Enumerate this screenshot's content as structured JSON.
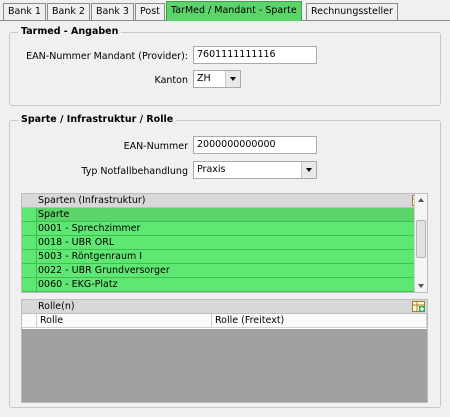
{
  "tabs": [
    {
      "label": "Bank 1",
      "active": false
    },
    {
      "label": "Bank 2",
      "active": false
    },
    {
      "label": "Bank 3",
      "active": false
    },
    {
      "label": "Post",
      "active": false
    },
    {
      "label": "TarMed / Mandant - Sparte",
      "active": true
    },
    {
      "label": "Rechnungssteller",
      "active": false
    }
  ],
  "tarmed": {
    "title": "Tarmed - Angaben",
    "ean_label": "EAN-Nummer Mandant (Provider):",
    "ean_value": "7601111111116",
    "kanton_label": "Kanton",
    "kanton_value": "ZH"
  },
  "sparte": {
    "title": "Sparte / Infrastruktur / Rolle",
    "ean_label": "EAN-Nummer",
    "ean_value": "2000000000000",
    "notfall_label": "Typ Notfallbehandlung",
    "notfall_value": "Praxis"
  },
  "sparten_grid": {
    "caption": "Sparten (Infrastruktur)",
    "header": "Sparte",
    "rows": [
      "0001  - Sprechzimmer",
      "0018  - UBR ORL",
      "5003  - Röntgenraum I",
      "0022  - UBR Grundversorger",
      "0060  - EKG-Platz"
    ]
  },
  "rollen_grid": {
    "caption": "Rolle(n)",
    "col1": "Rolle",
    "col2": "Rolle (Freitext)"
  },
  "colors": {
    "active_tab": "#5bd46a",
    "row_green": "#5ee873",
    "empty_gray": "#a0a0a0"
  }
}
